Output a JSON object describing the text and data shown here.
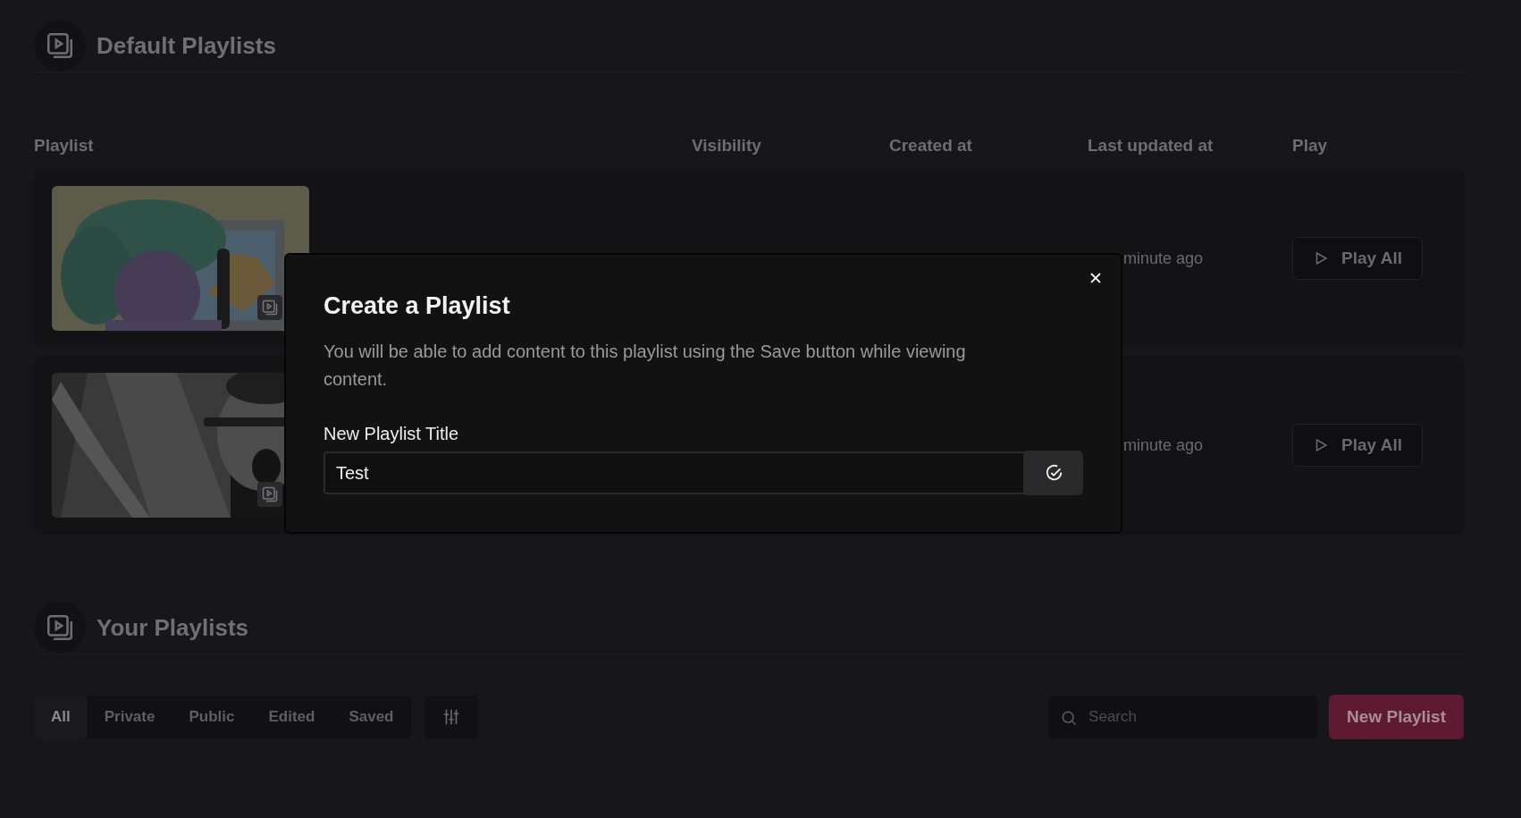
{
  "default_section": {
    "title": "Default Playlists"
  },
  "table": {
    "columns": [
      "Playlist",
      "Visibility",
      "Created at",
      "Last updated at",
      "Play"
    ],
    "rows": [
      {
        "last_updated": "minute ago",
        "play": "Play All"
      },
      {
        "last_updated": "minute ago",
        "play": "Play All"
      }
    ]
  },
  "your_section": {
    "title": "Your Playlists"
  },
  "filter_tabs": [
    {
      "label": "All",
      "selected": true
    },
    {
      "label": "Private",
      "selected": false
    },
    {
      "label": "Public",
      "selected": false
    },
    {
      "label": "Edited",
      "selected": false
    },
    {
      "label": "Saved",
      "selected": false
    }
  ],
  "search": {
    "placeholder": "Search"
  },
  "new_button": "New Playlist",
  "dialog": {
    "title": "Create a Playlist",
    "description": "You will be able to add content to this playlist using the Save button while viewing content.",
    "field_label": "New Playlist Title",
    "field_value": "Test"
  }
}
